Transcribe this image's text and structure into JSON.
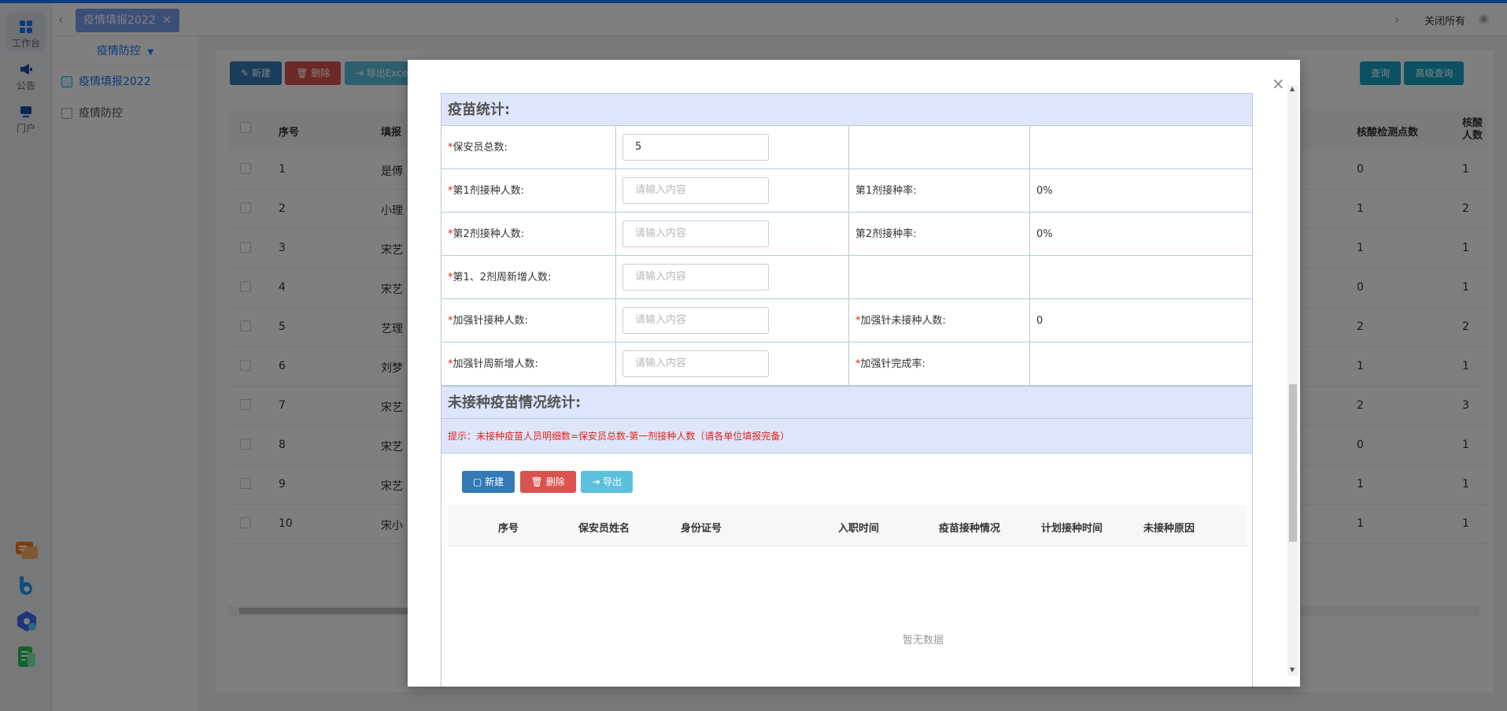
{
  "rail": {
    "workbench": "工作台",
    "notice": "公告",
    "portal": "门户"
  },
  "tabs": {
    "active": "疫情填报2022",
    "close_all": "关闭所有"
  },
  "menu": {
    "group": "疫情防控",
    "items": [
      "疫情填报2022",
      "疫情防控"
    ]
  },
  "toolbar": {
    "new": "新建",
    "delete": "删除",
    "export": "导出Excel",
    "query": "查询",
    "advanced": "高级查询"
  },
  "table": {
    "headers": [
      "序号",
      "填报",
      "核酸检测点数",
      "核酸人数"
    ],
    "rows": [
      {
        "no": "1",
        "name": "是傅",
        "a": "0",
        "b": "1"
      },
      {
        "no": "2",
        "name": "小理",
        "a": "1",
        "b": "2"
      },
      {
        "no": "3",
        "name": "宋艺",
        "a": "1",
        "b": "1"
      },
      {
        "no": "4",
        "name": "宋艺",
        "a": "0",
        "b": "1"
      },
      {
        "no": "5",
        "name": "艺理",
        "a": "2",
        "b": "2"
      },
      {
        "no": "6",
        "name": "刘梦",
        "a": "1",
        "b": "1"
      },
      {
        "no": "7",
        "name": "宋艺",
        "a": "2",
        "b": "3"
      },
      {
        "no": "8",
        "name": "宋艺",
        "a": "0",
        "b": "1"
      },
      {
        "no": "9",
        "name": "宋艺",
        "a": "1",
        "b": "1"
      },
      {
        "no": "10",
        "name": "宋小",
        "a": "1",
        "b": "1"
      }
    ]
  },
  "modal": {
    "section1": "疫苗统计:",
    "rows": [
      {
        "l1": "保安员总数:",
        "req1": true,
        "v1": "5",
        "ph1": false,
        "l2": "",
        "req2": false,
        "v2": ""
      },
      {
        "l1": "第1剂接种人数:",
        "req1": true,
        "v1": "请输入内容",
        "ph1": true,
        "l2": "第1剂接种率:",
        "req2": false,
        "v2": "0%"
      },
      {
        "l1": "第2剂接种人数:",
        "req1": true,
        "v1": "请输入内容",
        "ph1": true,
        "l2": "第2剂接种率:",
        "req2": false,
        "v2": "0%"
      },
      {
        "l1": "第1、2剂周新增人数:",
        "req1": true,
        "v1": "请输入内容",
        "ph1": true,
        "l2": "",
        "req2": false,
        "v2": ""
      },
      {
        "l1": "加强针接种人数:",
        "req1": true,
        "v1": "请输入内容",
        "ph1": true,
        "l2": "加强针未接种人数:",
        "req2": true,
        "v2": "0"
      },
      {
        "l1": "加强针周新增人数:",
        "req1": true,
        "v1": "请输入内容",
        "ph1": true,
        "l2": "加强针完成率:",
        "req2": true,
        "v2": ""
      }
    ],
    "section2": "未接种疫苗情况统计:",
    "hint": "提示：未接种疫苗人员明细数=保安员总数-第一剂接种人数（请各单位填报完备）",
    "sub_buttons": {
      "new": "新建",
      "delete": "删除",
      "export": "导出"
    },
    "sub_headers": [
      "序号",
      "保安员姓名",
      "身份证号",
      "入职时间",
      "疫苗接种情况",
      "计划接种时间",
      "未接种原因"
    ],
    "no_data": "暂无数据"
  }
}
